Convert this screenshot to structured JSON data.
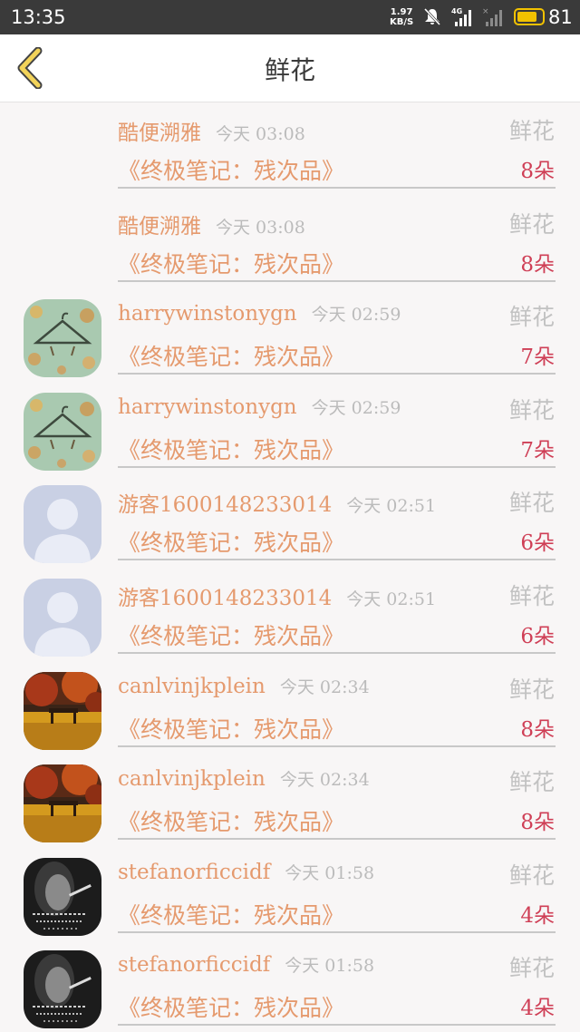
{
  "status_bar": {
    "time": "13:35",
    "speed_value": "1.97",
    "speed_unit": "KB/S",
    "network": "4G",
    "battery_level": "81",
    "battery_fraction": 0.81
  },
  "header": {
    "title": "鲜花",
    "back_icon": "chevron-left-icon"
  },
  "items": [
    {
      "user": "酷便溯雅",
      "time": "今天 03:08",
      "gift": "鲜花",
      "book": "《终极笔记：残次品》",
      "count": "8朵",
      "avatar": "none"
    },
    {
      "user": "酷便溯雅",
      "time": "今天 03:08",
      "gift": "鲜花",
      "book": "《终极笔记：残次品》",
      "count": "8朵",
      "avatar": "none"
    },
    {
      "user": "harrywinstonygn",
      "time": "今天 02:59",
      "gift": "鲜花",
      "book": "《终极笔记：残次品》",
      "count": "7朵",
      "avatar": "hanger-photo"
    },
    {
      "user": "harrywinstonygn",
      "time": "今天 02:59",
      "gift": "鲜花",
      "book": "《终极笔记：残次品》",
      "count": "7朵",
      "avatar": "hanger-photo"
    },
    {
      "user": "游客1600148233014",
      "time": "今天 02:51",
      "gift": "鲜花",
      "book": "《终极笔记：残次品》",
      "count": "6朵",
      "avatar": "default-person"
    },
    {
      "user": "游客1600148233014",
      "time": "今天 02:51",
      "gift": "鲜花",
      "book": "《终极笔记：残次品》",
      "count": "6朵",
      "avatar": "default-person"
    },
    {
      "user": "canlvinjkplein",
      "time": "今天 02:34",
      "gift": "鲜花",
      "book": "《终极笔记：残次品》",
      "count": "8朵",
      "avatar": "autumn-bench"
    },
    {
      "user": "canlvinjkplein",
      "time": "今天 02:34",
      "gift": "鲜花",
      "book": "《终极笔记：残次品》",
      "count": "8朵",
      "avatar": "autumn-bench"
    },
    {
      "user": "stefanorficcidf",
      "time": "今天 01:58",
      "gift": "鲜花",
      "book": "《终极笔记：残次品》",
      "count": "4朵",
      "avatar": "bw-smoker"
    },
    {
      "user": "stefanorficcidf",
      "time": "今天 01:58",
      "gift": "鲜花",
      "book": "《终极笔记：残次品》",
      "count": "4朵",
      "avatar": "bw-smoker"
    }
  ],
  "colors": {
    "username": "#e59a6e",
    "timestamp": "#bbbbbb",
    "gift_label": "#c2c2c2",
    "count": "#cf3f56",
    "back_arrow": "#f2d35a"
  }
}
